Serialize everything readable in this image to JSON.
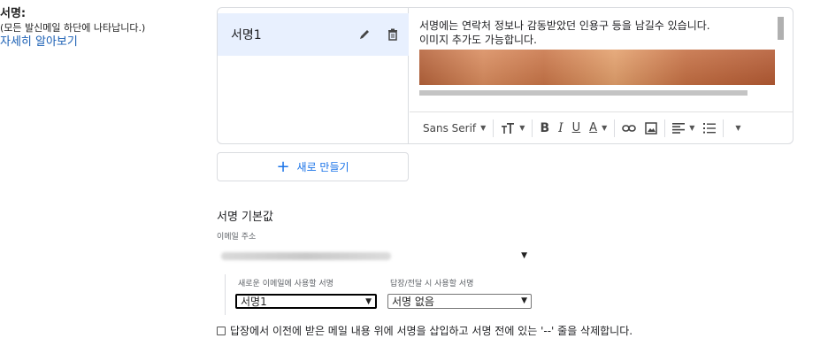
{
  "section": {
    "title": "서명:",
    "subtitle": "(모든 발신메일 하단에 나타납니다.)",
    "learn_more": "자세히 알아보기"
  },
  "signatures": [
    {
      "name": "서명1"
    }
  ],
  "editor": {
    "line1": "서명에는 연락처 정보나 감동받았던 인용구 등을 남길수 있습니다.",
    "line2": "이미지 추가도 가능합니다.",
    "font": "Sans Serif",
    "bold": "B",
    "italic": "I",
    "underline": "U",
    "text_color": "A"
  },
  "new_button": {
    "plus": "+",
    "label": "새로 만들기"
  },
  "defaults": {
    "title": "서명 기본값",
    "email_label": "이메일 주소",
    "new_mail_label": "새로운 이메일에 사용할 서명",
    "reply_label": "답장/전달 시 사용할 서명",
    "new_mail_value": "서명1",
    "reply_value": "서명 없음"
  },
  "checkbox": {
    "label": "답장에서 이전에 받은 메일 내용 위에 서명을 삽입하고 서명 전에 있는 '--' 줄을 삭제합니다."
  },
  "icons": [
    "pencil-icon",
    "trash-icon",
    "text-size-icon",
    "link-icon",
    "image-icon",
    "align-icon",
    "numbered-list-icon",
    "more-icon"
  ]
}
